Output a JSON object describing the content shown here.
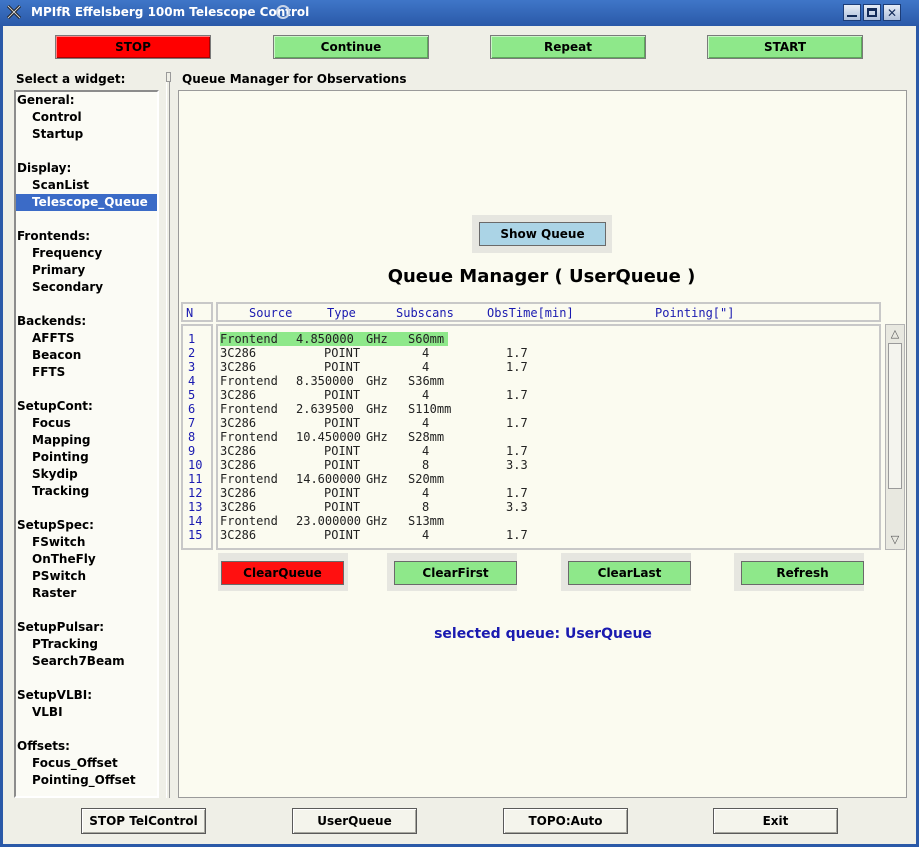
{
  "window": {
    "title": "MPIfR Effelsberg 100m Telescope Control"
  },
  "toolbar": {
    "stop": "STOP",
    "continue": "Continue",
    "repeat": "Repeat",
    "start": "START"
  },
  "sidebar": {
    "label": "Select a widget:",
    "selected": "Telescope_Queue",
    "lines": [
      {
        "type": "cat",
        "text": "General:"
      },
      {
        "type": "item",
        "text": "Control"
      },
      {
        "type": "item",
        "text": "Startup"
      },
      {
        "type": "blank",
        "text": ""
      },
      {
        "type": "cat",
        "text": "Display:"
      },
      {
        "type": "item",
        "text": "ScanList"
      },
      {
        "type": "item",
        "text": "Telescope_Queue"
      },
      {
        "type": "blank",
        "text": ""
      },
      {
        "type": "cat",
        "text": "Frontends:"
      },
      {
        "type": "item",
        "text": "Frequency"
      },
      {
        "type": "item",
        "text": "Primary"
      },
      {
        "type": "item",
        "text": "Secondary"
      },
      {
        "type": "blank",
        "text": ""
      },
      {
        "type": "cat",
        "text": "Backends:"
      },
      {
        "type": "item",
        "text": "AFFTS"
      },
      {
        "type": "item",
        "text": "Beacon"
      },
      {
        "type": "item",
        "text": "FFTS"
      },
      {
        "type": "blank",
        "text": ""
      },
      {
        "type": "cat",
        "text": "SetupCont:"
      },
      {
        "type": "item",
        "text": "Focus"
      },
      {
        "type": "item",
        "text": "Mapping"
      },
      {
        "type": "item",
        "text": "Pointing"
      },
      {
        "type": "item",
        "text": "Skydip"
      },
      {
        "type": "item",
        "text": "Tracking"
      },
      {
        "type": "blank",
        "text": ""
      },
      {
        "type": "cat",
        "text": "SetupSpec:"
      },
      {
        "type": "item",
        "text": "FSwitch"
      },
      {
        "type": "item",
        "text": "OnTheFly"
      },
      {
        "type": "item",
        "text": "PSwitch"
      },
      {
        "type": "item",
        "text": "Raster"
      },
      {
        "type": "blank",
        "text": ""
      },
      {
        "type": "cat",
        "text": "SetupPulsar:"
      },
      {
        "type": "item",
        "text": "PTracking"
      },
      {
        "type": "item",
        "text": "Search7Beam"
      },
      {
        "type": "blank",
        "text": ""
      },
      {
        "type": "cat",
        "text": "SetupVLBI:"
      },
      {
        "type": "item",
        "text": "VLBI"
      },
      {
        "type": "blank",
        "text": ""
      },
      {
        "type": "cat",
        "text": "Offsets:"
      },
      {
        "type": "item",
        "text": "Focus_Offset"
      },
      {
        "type": "item",
        "text": "Pointing_Offset"
      }
    ]
  },
  "panel": {
    "label": "Queue Manager for Observations",
    "show_queue": "Show Queue",
    "title": "Queue Manager ( UserQueue )",
    "table": {
      "n_header": "N",
      "headers": [
        "Source",
        "Type",
        "Subscans",
        "ObsTime[min]",
        "Pointing[\"]"
      ],
      "rows": [
        {
          "n": "1",
          "kind": "frontend",
          "a": "Frontend",
          "b": "4.850000",
          "c": "GHz",
          "d": "S60mm",
          "highlight": true
        },
        {
          "n": "2",
          "kind": "scan",
          "a": "3C286",
          "b": "POINT",
          "c": "4",
          "d": "1.7"
        },
        {
          "n": "3",
          "kind": "scan",
          "a": "3C286",
          "b": "POINT",
          "c": "4",
          "d": "1.7"
        },
        {
          "n": "4",
          "kind": "frontend",
          "a": "Frontend",
          "b": "8.350000",
          "c": "GHz",
          "d": "S36mm"
        },
        {
          "n": "5",
          "kind": "scan",
          "a": "3C286",
          "b": "POINT",
          "c": "4",
          "d": "1.7"
        },
        {
          "n": "6",
          "kind": "frontend",
          "a": "Frontend",
          "b": "2.639500",
          "c": "GHz",
          "d": "S110mm"
        },
        {
          "n": "7",
          "kind": "scan",
          "a": "3C286",
          "b": "POINT",
          "c": "4",
          "d": "1.7"
        },
        {
          "n": "8",
          "kind": "frontend",
          "a": "Frontend",
          "b": "10.450000",
          "c": "GHz",
          "d": "S28mm"
        },
        {
          "n": "9",
          "kind": "scan",
          "a": "3C286",
          "b": "POINT",
          "c": "4",
          "d": "1.7"
        },
        {
          "n": "10",
          "kind": "scan",
          "a": "3C286",
          "b": "POINT",
          "c": "8",
          "d": "3.3"
        },
        {
          "n": "11",
          "kind": "frontend",
          "a": "Frontend",
          "b": "14.600000",
          "c": "GHz",
          "d": "S20mm"
        },
        {
          "n": "12",
          "kind": "scan",
          "a": "3C286",
          "b": "POINT",
          "c": "4",
          "d": "1.7"
        },
        {
          "n": "13",
          "kind": "scan",
          "a": "3C286",
          "b": "POINT",
          "c": "8",
          "d": "3.3"
        },
        {
          "n": "14",
          "kind": "frontend",
          "a": "Frontend",
          "b": "23.000000",
          "c": "GHz",
          "d": "S13mm"
        },
        {
          "n": "15",
          "kind": "scan",
          "a": "3C286",
          "b": "POINT",
          "c": "4",
          "d": "1.7"
        }
      ]
    },
    "buttons": {
      "clear_queue": "ClearQueue",
      "clear_first": "ClearFirst",
      "clear_last": "ClearLast",
      "refresh": "Refresh"
    },
    "selected_queue": "selected queue: UserQueue"
  },
  "footer": {
    "stop_tel": "STOP TelControl",
    "user_queue": "UserQueue",
    "topo": "TOPO:Auto",
    "exit": "Exit"
  },
  "colors": {
    "stop": "#ff0000",
    "green": "#8ee88a",
    "blue_text": "#1a1ab0",
    "selection": "#3b6bc7",
    "show_queue": "#abd4e6"
  }
}
